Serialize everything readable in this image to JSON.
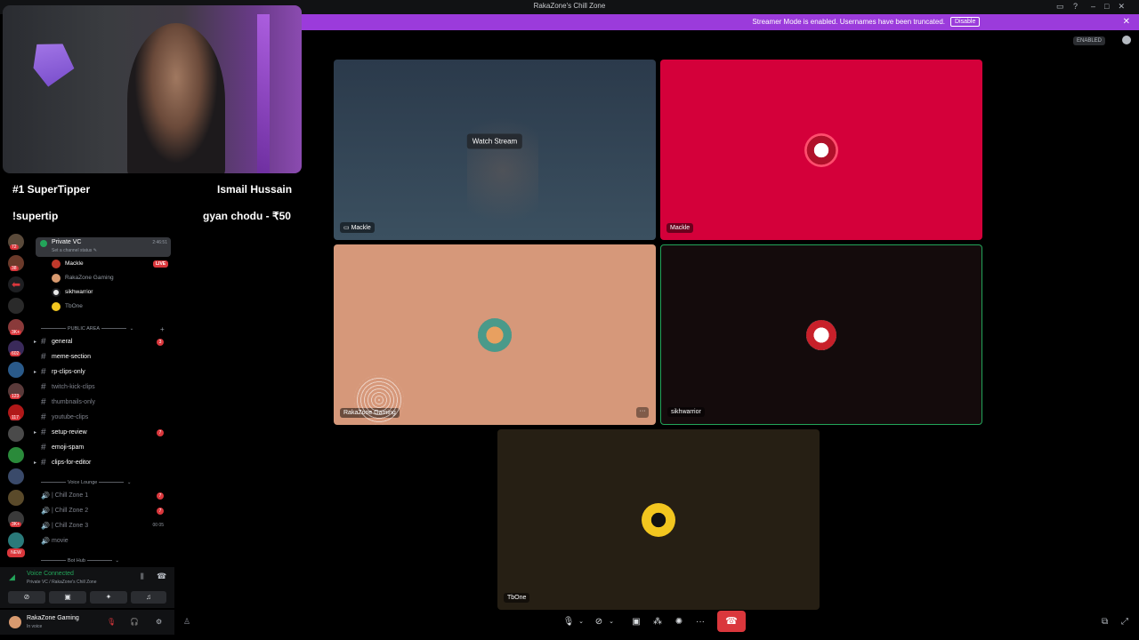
{
  "window": {
    "title": "RakaZone's Chill Zone"
  },
  "notice": {
    "text": "Streamer Mode is enabled. Usernames have been truncated.",
    "disable_label": "Disable",
    "close_label": "✕"
  },
  "header": {
    "streamer_pill": "ENABLED"
  },
  "overlay": {
    "supertipper_title": "#1 SuperTipper",
    "supertipper_name": "Ismail Hussain",
    "command": "!supertip",
    "tip_line": "gyan chodu - ₹50"
  },
  "colors": {
    "accent_purple": "#9b3bdb",
    "live_red": "#da373c",
    "voice_green": "#23a55a",
    "tile_mackle_red": "#d4003a",
    "tile_raka_peach": "#d6987a",
    "tile_sikh_dark": "#140b0c",
    "tile_tbone_dark": "#261f14"
  },
  "server_rail": {
    "badges": [
      "72",
      "38",
      "3K+",
      "602",
      "123",
      "117",
      "3K+",
      "NEW"
    ]
  },
  "channels": {
    "private_vc": {
      "name": "Private VC",
      "status": "Set a channel status ✎",
      "time": "2:46:51"
    },
    "members": [
      {
        "name": "Mackle",
        "live": "LIVE"
      },
      {
        "name": "RakaZone Gaming"
      },
      {
        "name": "sikhwarrior"
      },
      {
        "name": "TbOne"
      }
    ],
    "public_area_label": "PUBLIC AREA",
    "text_channels": [
      {
        "name": "general",
        "badge": "3",
        "bold": true
      },
      {
        "name": "meme-section",
        "bold": true
      },
      {
        "name": "rp-clips-only",
        "bold": true
      },
      {
        "name": "twitch-kick-clips",
        "bold": false
      },
      {
        "name": "thumbnails-only",
        "bold": false
      },
      {
        "name": "youtube-clips",
        "bold": false
      },
      {
        "name": "setup-review",
        "badge": "7",
        "bold": true
      },
      {
        "name": "emoji-spam",
        "bold": true
      },
      {
        "name": "clips-for-editor",
        "bold": true
      }
    ],
    "voice_lounge_label": "Voice Lounge",
    "voice_channels": [
      {
        "name": "| Chill Zone 1",
        "badge": "7"
      },
      {
        "name": "| Chill Zone 2",
        "badge": "7"
      },
      {
        "name": "| Chill Zone 3",
        "limit": "00 05"
      },
      {
        "name": "movie"
      }
    ],
    "bot_hub_label": "Bot Hub"
  },
  "voice_bar": {
    "status": "Voice Connected",
    "location": "Private VC / RakaZone's Chill Zone"
  },
  "user_bar": {
    "name": "RakaZone Gaming",
    "status": "In voice"
  },
  "tiles": [
    {
      "label": "Mackle",
      "overlay": "Watch Stream"
    },
    {
      "label": "Mackle"
    },
    {
      "label": "RakaZone Gaming"
    },
    {
      "label": "sikhwarrior"
    },
    {
      "label": "TbOne"
    }
  ],
  "icons": {
    "mic": "microphone-icon",
    "camera": "camera-off-icon",
    "screen": "screen-share-icon",
    "activities": "activities-icon",
    "soundboard": "soundboard-icon",
    "more": "more-icon",
    "hangup": "hang-up-icon",
    "popout": "popout-icon",
    "fullscreen": "fullscreen-icon"
  }
}
